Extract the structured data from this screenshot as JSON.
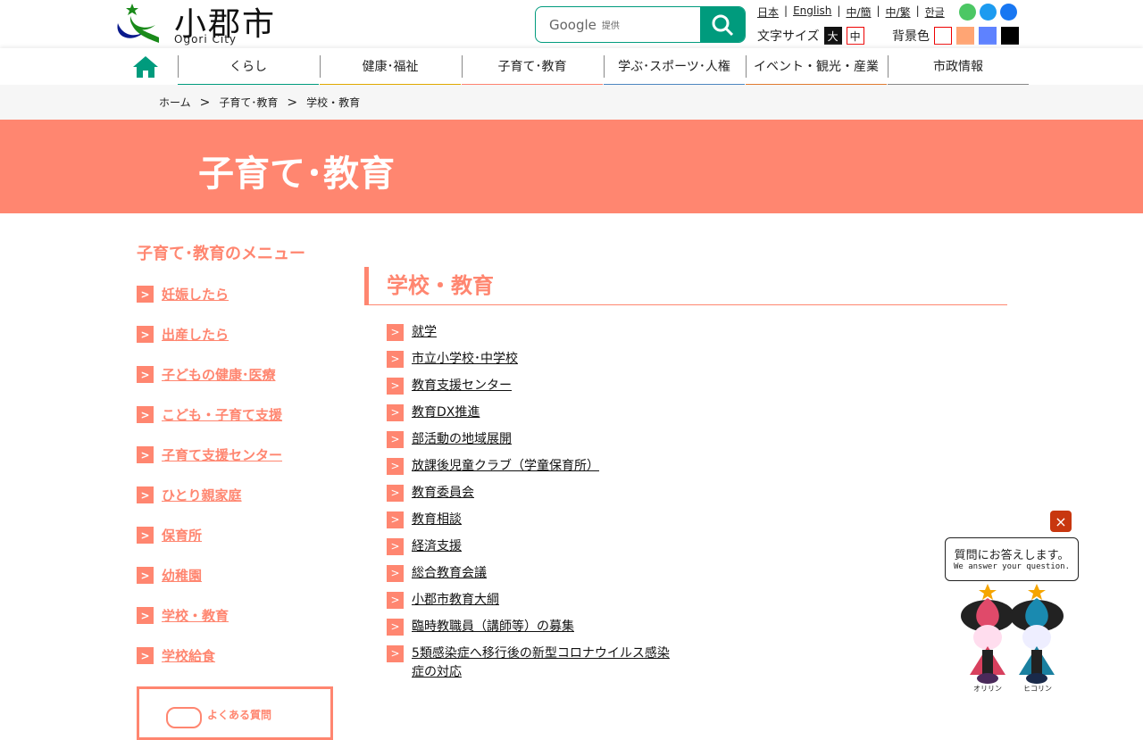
{
  "header": {
    "city_name": "小郡市",
    "city_sub": "Ogori City",
    "search_placeholder": "Google",
    "search_provided": "提供",
    "languages": [
      "日本",
      "English",
      "中/簡",
      "中/繁",
      "한글"
    ],
    "font_size_label": "文字サイズ",
    "font_sizes": [
      "大",
      "中"
    ],
    "bg_label": "背景色",
    "bg_colors": [
      "#ffffff",
      "#ffa574",
      "#5e82ff",
      "#000000"
    ]
  },
  "nav": {
    "items": [
      {
        "label": "くらし",
        "color": "#009b7d"
      },
      {
        "label": "健康･福祉",
        "color": "#e0a800"
      },
      {
        "label": "子育て･教育",
        "color": "#ff8370"
      },
      {
        "label": "学ぶ･スポーツ･人権",
        "color": "#4d86c0"
      },
      {
        "label": "イベント・観光・産業",
        "color": "#e07a30"
      },
      {
        "label": "市政情報",
        "color": "#888888"
      }
    ]
  },
  "breadcrumb": {
    "home": "ホーム",
    "parent": "子育て･教育",
    "current": "学校・教育",
    "sep": ">"
  },
  "banner": {
    "title": "子育て･教育"
  },
  "sidebar": {
    "title": "子育て･教育のメニュー",
    "items": [
      "妊娠したら",
      "出産したら",
      "子どもの健康･医療",
      "こども・子育て支援",
      "子育て支援センター",
      "ひとり親家庭",
      "保育所",
      "幼稚園",
      "学校・教育",
      "学校給食"
    ],
    "faq": "よくある質問"
  },
  "main": {
    "heading": "学校・教育",
    "links": [
      "就学",
      "市立小学校･中学校",
      "教育支援センター",
      "教育DX推進",
      "部活動の地域展開",
      "放課後児童クラブ（学童保育所）",
      "教育委員会",
      "教育相談",
      "経済支援",
      "総合教育会議",
      "小郡市教育大綱",
      "臨時教職員（講師等）の募集",
      "5類感染症へ移行後の新型コロナウイルス感染症の対応"
    ]
  },
  "chatbot": {
    "close": "×",
    "question_jp": "質問にお答えします。",
    "question_en": "We answer your question.",
    "char1": "オリリン",
    "char2": "ヒコリン"
  }
}
